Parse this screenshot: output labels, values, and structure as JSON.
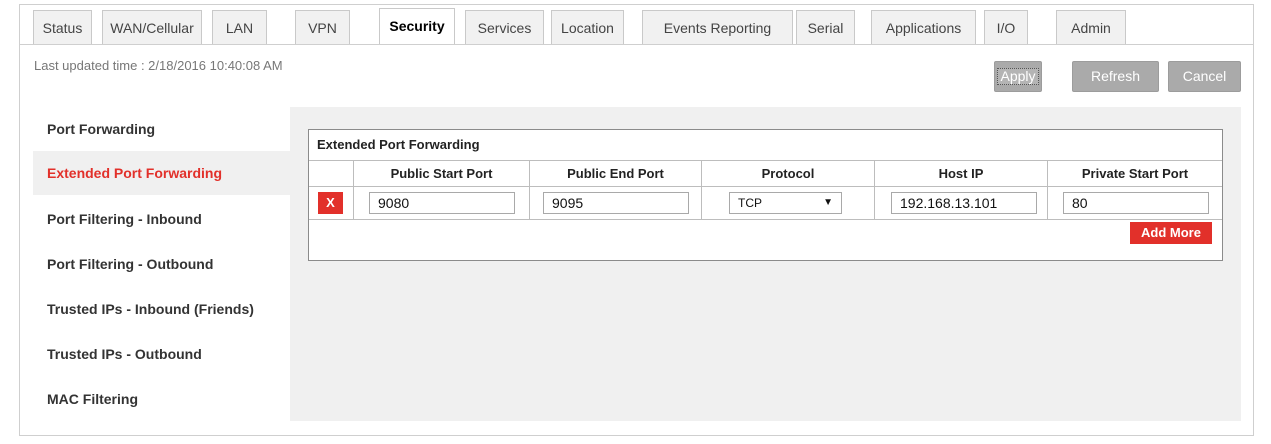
{
  "tabs": [
    {
      "label": "Status"
    },
    {
      "label": "WAN/Cellular"
    },
    {
      "label": "LAN"
    },
    {
      "label": "VPN"
    },
    {
      "label": "Security",
      "active": true
    },
    {
      "label": "Services"
    },
    {
      "label": "Location"
    },
    {
      "label": "Events Reporting"
    },
    {
      "label": "Serial"
    },
    {
      "label": "Applications"
    },
    {
      "label": "I/O"
    },
    {
      "label": "Admin"
    }
  ],
  "header": {
    "last_updated": "Last updated time : 2/18/2016 10:40:08 AM",
    "apply_label": "Apply",
    "refresh_label": "Refresh",
    "cancel_label": "Cancel"
  },
  "sidebar": {
    "items": [
      {
        "label": "Port Forwarding"
      },
      {
        "label": "Extended Port Forwarding",
        "active": true
      },
      {
        "label": "Port Filtering - Inbound"
      },
      {
        "label": "Port Filtering - Outbound"
      },
      {
        "label": "Trusted IPs - Inbound (Friends)"
      },
      {
        "label": "Trusted IPs - Outbound"
      },
      {
        "label": "MAC Filtering"
      }
    ]
  },
  "table": {
    "title": "Extended Port Forwarding",
    "columns": [
      "Public Start Port",
      "Public End Port",
      "Protocol",
      "Host IP",
      "Private Start Port"
    ],
    "row": {
      "delete_label": "X",
      "public_start_port": "9080",
      "public_end_port": "9095",
      "protocol": "TCP",
      "host_ip": "192.168.13.101",
      "private_start_port": "80"
    },
    "add_more_label": "Add More"
  },
  "colors": {
    "accent": "#e2302a",
    "button_gray": "#aaaaaa",
    "content_bg": "#f0f0f0"
  }
}
